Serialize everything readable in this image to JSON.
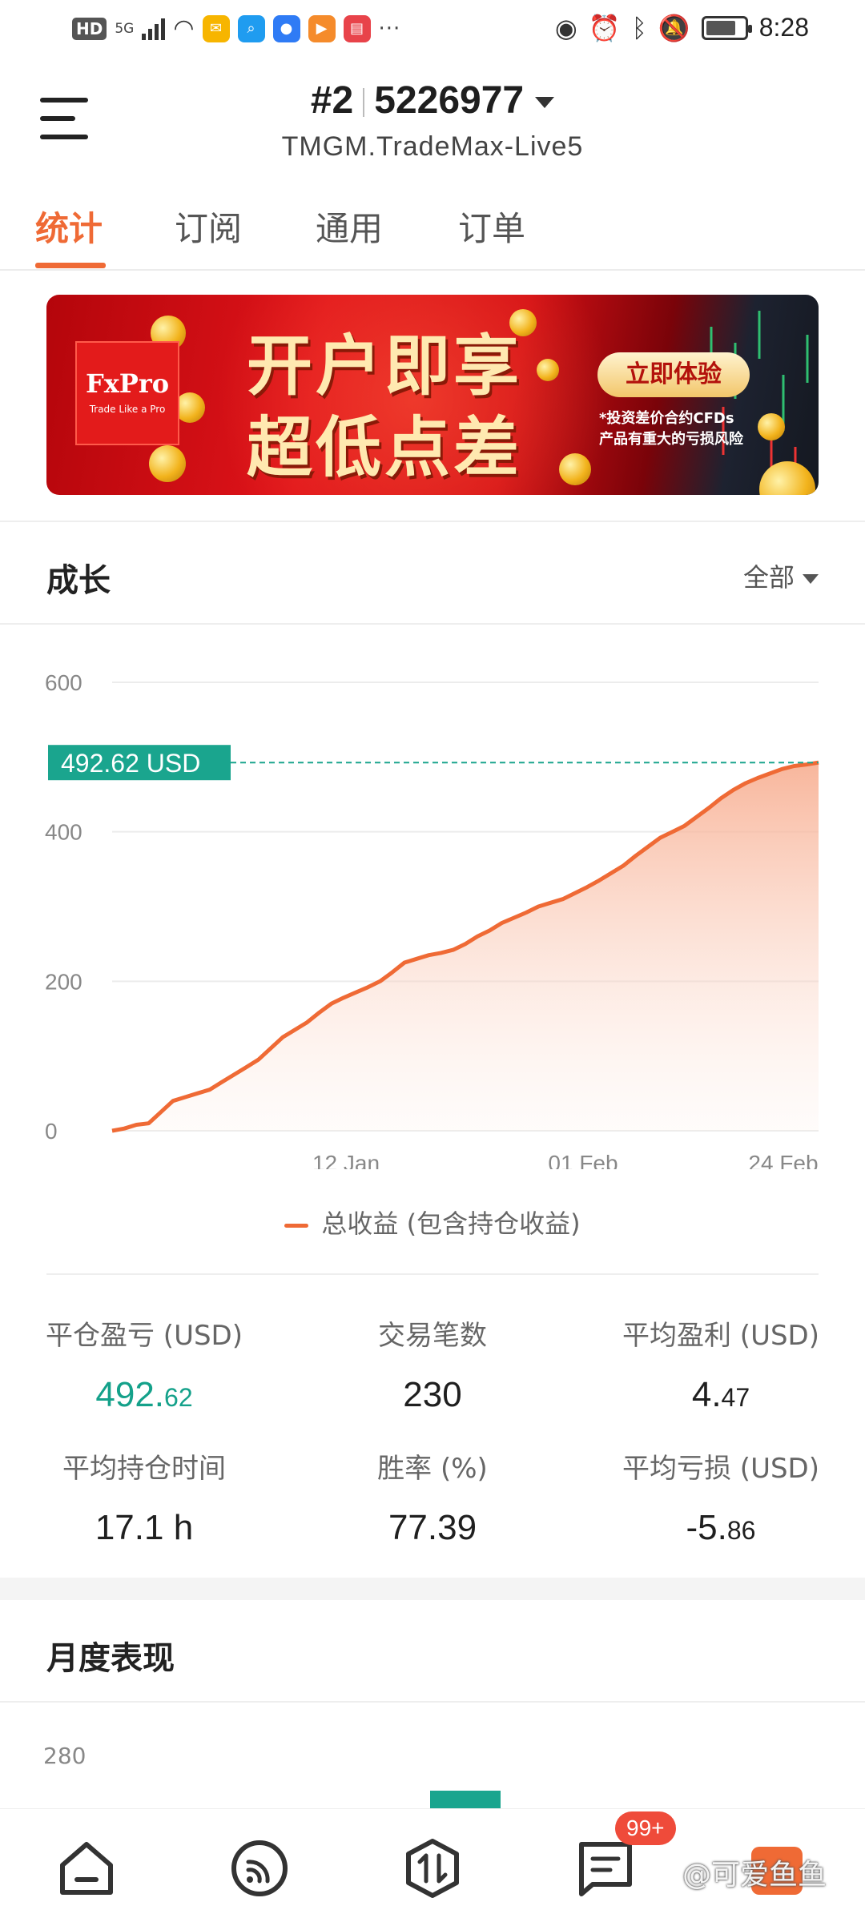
{
  "status_bar": {
    "left_badge": "HD",
    "signal_label": "5G",
    "more_dots": "···",
    "time": "8:28"
  },
  "header": {
    "account_index": "#2",
    "account_number": "5226977",
    "server": "TMGM.TradeMax-Live5"
  },
  "tabs": [
    {
      "label": "统计",
      "active": true
    },
    {
      "label": "订阅",
      "active": false
    },
    {
      "label": "通用",
      "active": false
    },
    {
      "label": "订单",
      "active": false
    }
  ],
  "banner": {
    "brand": "FxPro",
    "brand_tagline": "Trade Like a Pro",
    "headline_line1": "开户即享",
    "headline_line2": "超低点差",
    "cta": "立即体验",
    "risk_line1": "*投资差价合约CFDs",
    "risk_line2": "产品有重大的亏损风险"
  },
  "growth": {
    "title": "成长",
    "range_selector": "全部",
    "current_value_label": "492.62 USD",
    "legend": "总收益 (包含持仓收益)"
  },
  "chart_data": {
    "type": "area",
    "y_ticks": [
      "600",
      "400",
      "200",
      "0"
    ],
    "x_ticks": [
      "12 Jan",
      "01 Feb",
      "24 Feb"
    ],
    "ylim": [
      0,
      600
    ],
    "grid": true,
    "series": [
      {
        "name": "总收益 (包含持仓收益)",
        "color": "#ef6a35",
        "values": [
          0,
          3,
          8,
          10,
          25,
          40,
          45,
          50,
          55,
          65,
          75,
          85,
          95,
          110,
          125,
          135,
          145,
          158,
          170,
          178,
          185,
          192,
          200,
          212,
          225,
          230,
          235,
          238,
          242,
          250,
          260,
          268,
          278,
          285,
          292,
          300,
          305,
          310,
          318,
          326,
          335,
          345,
          355,
          368,
          380,
          392,
          400,
          408,
          420,
          432,
          445,
          456,
          465,
          472,
          478,
          484,
          488,
          490,
          492.62
        ]
      }
    ],
    "current_value": 492.62
  },
  "stats": [
    {
      "label": "平仓盈亏 (USD)",
      "int": "492.",
      "dec": "62",
      "color": "green"
    },
    {
      "label": "交易笔数",
      "int": "230",
      "dec": "",
      "color": "default"
    },
    {
      "label": "平均盈利 (USD)",
      "int": "4.",
      "dec": "47",
      "color": "default"
    },
    {
      "label": "平均持仓时间",
      "int": "17.1 h",
      "dec": "",
      "color": "default"
    },
    {
      "label": "胜率 (%)",
      "int": "77.39",
      "dec": "",
      "color": "default"
    },
    {
      "label": "平均亏损 (USD)",
      "int": "-5.",
      "dec": "86",
      "color": "default"
    }
  ],
  "monthly": {
    "title": "月度表现",
    "y_tick": "280"
  },
  "bottom_nav": {
    "items": [
      "home-icon",
      "signal-icon",
      "trade-icon",
      "messages-icon",
      "gift-icon"
    ],
    "messages_badge": "99+"
  },
  "watermark": "@可爱鱼鱼"
}
